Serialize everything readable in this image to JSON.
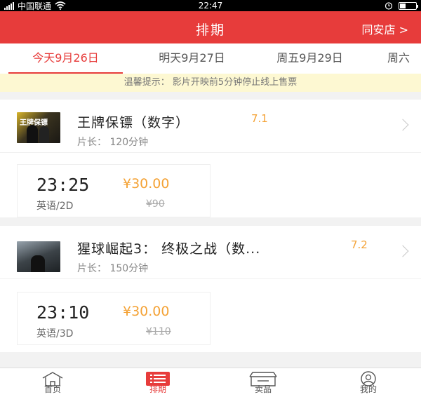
{
  "status_bar": {
    "carrier": "中国联通",
    "time": "22:47"
  },
  "header": {
    "title": "排期",
    "store": "同安店 >"
  },
  "tabs": [
    {
      "label": "今天9月26日"
    },
    {
      "label": "明天9月27日"
    },
    {
      "label": "周五9月29日"
    },
    {
      "label": "周六"
    }
  ],
  "notice": "温馨提示： 影片开映前5分钟停止线上售票",
  "movies": [
    {
      "title": "王牌保镖（数字）",
      "rating": "7.1",
      "length": "片长： 120分钟",
      "poster_text": "王牌保镖",
      "showtime": {
        "time": "23:25",
        "price": "¥30.00",
        "lang": "英语/2D",
        "original_price": "¥90"
      }
    },
    {
      "title": "猩球崛起3： 终极之战（数...",
      "rating": "7.2",
      "length": "片长： 150分钟",
      "showtime": {
        "time": "23:10",
        "price": "¥30.00",
        "lang": "英语/3D",
        "original_price": "¥110"
      }
    }
  ],
  "bottom_nav": [
    {
      "label": "首页",
      "icon": "home-icon"
    },
    {
      "label": "排期",
      "icon": "schedule-icon"
    },
    {
      "label": "卖品",
      "icon": "store-icon"
    },
    {
      "label": "我的",
      "icon": "profile-icon"
    }
  ],
  "colors": {
    "accent": "#e73c3b",
    "price": "#f4a235",
    "notice_bg": "#fdf8d2"
  }
}
